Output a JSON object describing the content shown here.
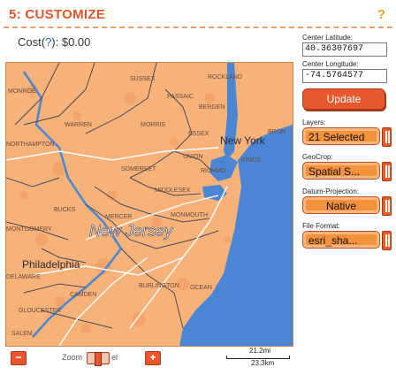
{
  "header": {
    "title": "5: CUSTOMIZE",
    "help": "?"
  },
  "cost": {
    "prefix": "Cost(",
    "q": "?",
    "suffix": "): $0.00"
  },
  "side": {
    "lat_label": "Center Latitude:",
    "lat_value": "40.36307697",
    "lon_label": "Center Longitude:",
    "lon_value": "-74.5764577",
    "update_label": "Update",
    "layers_label": "Layers:",
    "layers_value": "21 Selected",
    "geocrop_label": "GeoCrop:",
    "geocrop_value": "Spatial S...",
    "datum_label": "Datum-Projection:",
    "datum_value": "Native",
    "format_label": "File Format:",
    "format_value": "esri_sha..."
  },
  "map": {
    "labels": {
      "sussex": "SUSSEX",
      "rockland": "ROCKLAND",
      "monroe": "MONROE",
      "passaic": "PASSAIC",
      "bergen": "BERGEN",
      "warren": "WARREN",
      "morris": "MORRIS",
      "essex": "ESSEX",
      "bronx": "BRON",
      "newyork": "New York",
      "northampton": "NORTHAMPTON",
      "union": "UNION",
      "kings": "KINGS",
      "somerset": "SOMERSET",
      "richmond": "RICHMO",
      "middlesex": "MIDDLESEX",
      "bucks": "BUCKS",
      "mercer": "MERCER",
      "monmouth": "MONMOUTH",
      "montgomery": "MONTGOMERY",
      "newjersey": "New Jersey",
      "philadelphia": "Philadelphia",
      "delaware": "DELAWARE",
      "burlington": "BURLINGTON",
      "ocean": "OCEAN",
      "camden": "CAMDEN",
      "gloucester": "GLOUCESTER",
      "salem": "SALEM"
    }
  },
  "zoom": {
    "minus": "−",
    "plus": "+",
    "label": "Zoom",
    "label2": "el"
  },
  "scale": {
    "mi": "21.2mi",
    "km": "23.3km"
  }
}
